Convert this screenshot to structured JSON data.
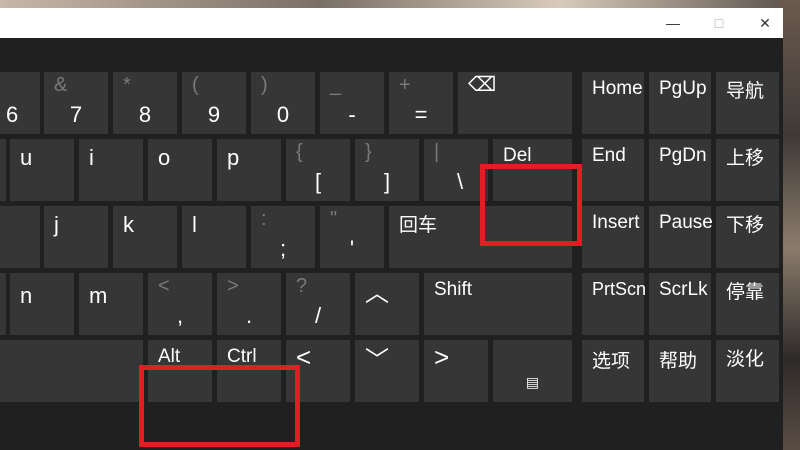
{
  "window": {
    "minimize_icon": "—",
    "maximize_icon": "□",
    "close_icon": "✕"
  },
  "keys": {
    "k6": {
      "bottom": "6"
    },
    "k7": {
      "top": "&",
      "bottom": "7"
    },
    "k8": {
      "top": "*",
      "bottom": "8"
    },
    "k9": {
      "top": "(",
      "bottom": "9"
    },
    "k0": {
      "top": ")",
      "bottom": "0"
    },
    "minus": {
      "top": "_",
      "bottom": "-"
    },
    "equals": {
      "top": "+",
      "bottom": "="
    },
    "backspace": {
      "icon": "⌫"
    },
    "home": "Home",
    "pgup": "PgUp",
    "nav": "导航",
    "u": "u",
    "i": "i",
    "o": "o",
    "p": "p",
    "lbrace": {
      "top": "{",
      "bottom": "["
    },
    "rbrace": {
      "top": "}",
      "bottom": "]"
    },
    "pipe": {
      "top": "|",
      "bottom": "\\"
    },
    "del": "Del",
    "end": "End",
    "pgdn": "PgDn",
    "moveup": "上移",
    "j": "j",
    "k": "k",
    "l": "l",
    "colon": {
      "top": ":",
      "bottom": ";"
    },
    "quote": {
      "top": "\"",
      "bottom": "'"
    },
    "enter": "回车",
    "insert": "Insert",
    "pause": "Pause",
    "movedown": "下移",
    "n": "n",
    "m": "m",
    "lt": {
      "top": "<",
      "bottom": ","
    },
    "gt": {
      "top": ">",
      "bottom": "."
    },
    "question": {
      "top": "?",
      "bottom": "/"
    },
    "uparrow": "︿",
    "shift": "Shift",
    "prtscn": "PrtScn",
    "scrlk": "ScrLk",
    "dock": "停靠",
    "alt": "Alt",
    "ctrl": "Ctrl",
    "leftarrow": "<",
    "downarrow": "﹀",
    "rightarrow": ">",
    "menu_icon": "▤",
    "options": "选项",
    "help": "帮助",
    "fade": "淡化"
  },
  "highlight_color": "#e21d24"
}
